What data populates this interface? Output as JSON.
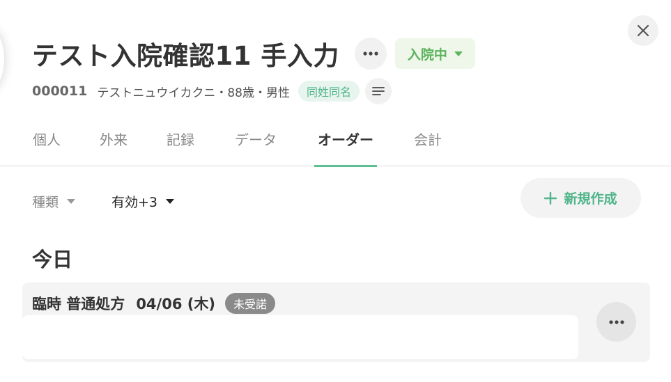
{
  "header": {
    "title": "テスト入院確認11 手入力",
    "status_label": "入院中",
    "status_color": "#5bb35b"
  },
  "patient": {
    "id": "000011",
    "info": "テストニュウイカクニ・88歳・男性",
    "same_name_badge": "同姓同名"
  },
  "tabs": [
    {
      "label": "個人"
    },
    {
      "label": "外来"
    },
    {
      "label": "記録"
    },
    {
      "label": "データ"
    },
    {
      "label": "オーダー",
      "active": true
    },
    {
      "label": "会計"
    }
  ],
  "filters": {
    "kind_label": "種類",
    "valid_label": "有効+3"
  },
  "actions": {
    "new_label": "新規作成"
  },
  "section": {
    "heading": "今日"
  },
  "order": {
    "title": "臨時 普通処方",
    "date": "04/06 (木)",
    "status": "未受諾"
  },
  "icons": {
    "close": "close-icon",
    "more": "more-horizontal-icon",
    "dropdown": "caret-down-icon",
    "list": "list-icon",
    "plus": "plus-icon"
  },
  "colors": {
    "accent": "#5cbf93",
    "accent_text": "#4fb48a",
    "status_bg": "#eef7ea"
  }
}
